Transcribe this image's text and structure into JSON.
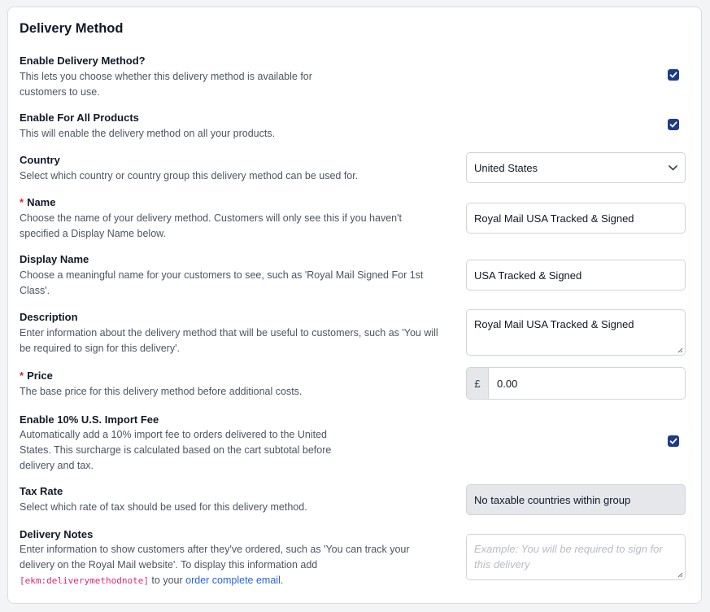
{
  "title": "Delivery Method",
  "accent_color": "#1e3a8a",
  "rows": {
    "enable": {
      "label": "Enable Delivery Method?",
      "desc1": "This lets you choose whether this delivery method is available for",
      "desc2": "customers to use.",
      "checked": true
    },
    "all_products": {
      "label": "Enable For All Products",
      "desc1": "This will enable the delivery method on all your products.",
      "checked": true
    },
    "country": {
      "label": "Country",
      "desc1": "Select which country or country group this delivery method can be used for.",
      "value": "United States",
      "icon": "chevron-down-icon"
    },
    "name": {
      "required_mark": "*",
      "label": "Name",
      "desc1": "Choose the name of your delivery method. Customers will only see this if you haven't",
      "desc2": "specified a Display Name below.",
      "value": "Royal Mail USA Tracked & Signed"
    },
    "display_name": {
      "label": "Display Name",
      "desc1": "Choose a meaningful name for your customers to see, such as 'Royal Mail Signed For 1st",
      "desc2": "Class'.",
      "value": "USA Tracked & Signed"
    },
    "description": {
      "label": "Description",
      "desc1": "Enter information about the delivery method that will be useful to customers, such as 'You will",
      "desc2": "be required to sign for this delivery'.",
      "value": "Royal Mail USA Tracked & Signed"
    },
    "price": {
      "required_mark": "*",
      "label": "Price",
      "desc1": "The base price for this delivery method before additional costs.",
      "currency": "£",
      "value": "0.00"
    },
    "import_fee": {
      "label": "Enable 10% U.S. Import Fee",
      "desc1": "Automatically add a 10% import fee to orders delivered to the United",
      "desc2": "States. This surcharge is calculated based on the cart subtotal before",
      "desc3": "delivery and tax.",
      "checked": true
    },
    "tax_rate": {
      "label": "Tax Rate",
      "desc1": "Select which rate of tax should be used for this delivery method.",
      "value": "No taxable countries within group"
    },
    "delivery_notes": {
      "label": "Delivery Notes",
      "desc1": "Enter information to show customers after they've ordered, such as 'You can track your",
      "desc2": "delivery on the Royal Mail website'. To display this information add",
      "code": "[ekm:deliverymethodnote]",
      "desc3_mid": " to your ",
      "link": "order complete email",
      "desc3_end": ".",
      "placeholder": "Example: You will be required to sign for this delivery"
    }
  }
}
